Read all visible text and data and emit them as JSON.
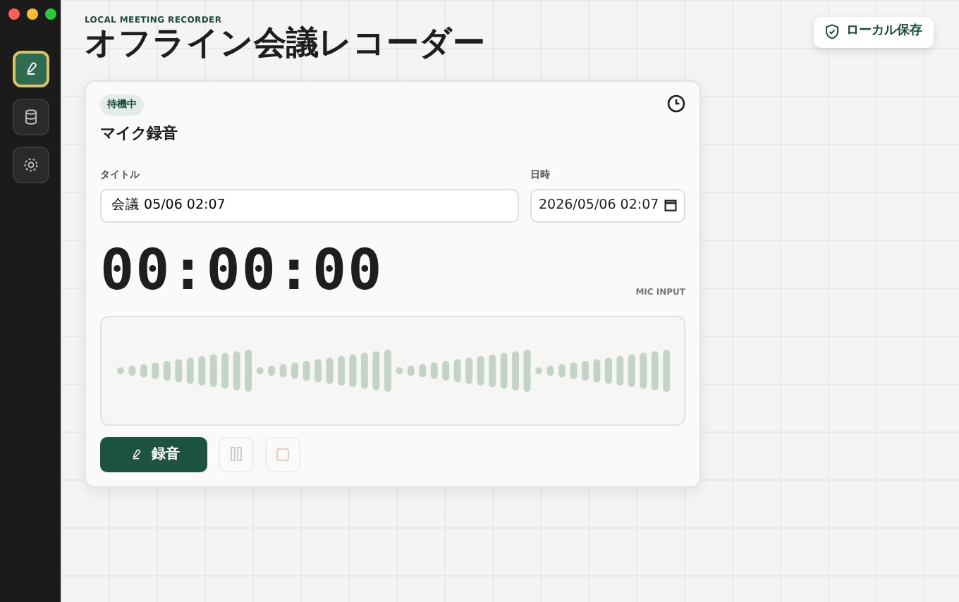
{
  "sidebar": {
    "items": [
      {
        "selected": true
      },
      {
        "selected": false
      },
      {
        "selected": false
      }
    ]
  },
  "header": {
    "eyebrow": "LOCAL MEETING RECORDER",
    "title": "オフライン会議レコーダー",
    "storage_badge": "ローカル保存"
  },
  "recorder": {
    "status": "待機中",
    "heading": "マイク録音",
    "title_field": {
      "label": "タイトル",
      "value": "会議 05/06 02:07"
    },
    "datetime_field": {
      "label": "日時",
      "value": "2026/05/06 02:07"
    },
    "timer": "00:00:00",
    "input_label": "MIC INPUT",
    "buttons": [
      {
        "kind": "record",
        "label": "録音"
      },
      {
        "kind": "pause",
        "disabled": true
      },
      {
        "kind": "stop",
        "disabled": true
      }
    ]
  }
}
